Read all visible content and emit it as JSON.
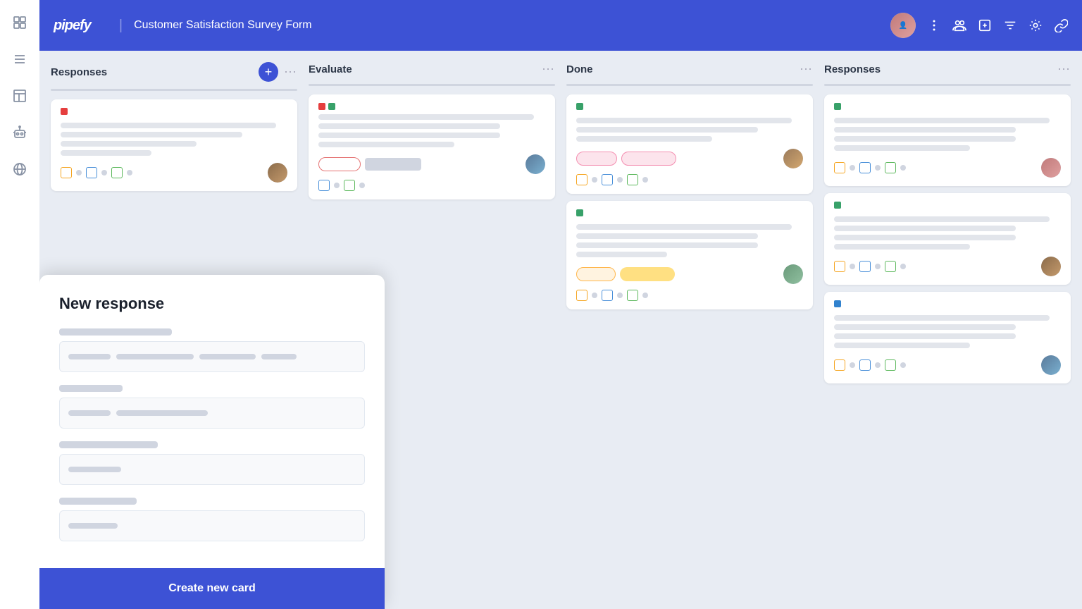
{
  "sidebar": {
    "icons": [
      "grid",
      "list",
      "table",
      "bot",
      "globe"
    ]
  },
  "header": {
    "logo": "pipefy",
    "title": "Customer Satisfaction Survey Form",
    "actions": [
      "people",
      "export",
      "filter",
      "settings",
      "link"
    ]
  },
  "columns": [
    {
      "id": "responses-1",
      "title": "Responses",
      "hasAdd": true,
      "cards": [
        {
          "indicator": "red",
          "lines": [
            "long",
            "medium",
            "short",
            "tiny"
          ],
          "badges": [],
          "icons": [
            "orange",
            "blue",
            "green"
          ],
          "avatar": "av1"
        }
      ]
    },
    {
      "id": "evaluate",
      "title": "Evaluate",
      "hasAdd": false,
      "cards": [
        {
          "indicators": [
            "red",
            "green"
          ],
          "lines": [
            "long",
            "medium",
            "medium",
            "short"
          ],
          "badges": [
            "outline"
          ],
          "icons": [
            "blue",
            "green"
          ],
          "avatar": "av2"
        }
      ]
    },
    {
      "id": "done",
      "title": "Done",
      "hasAdd": false,
      "cards": [
        {
          "indicator": "green",
          "lines": [
            "long",
            "medium",
            "short"
          ],
          "badges": [
            "pink",
            "pinkfill"
          ],
          "icons": [
            "orange",
            "blue",
            "green"
          ],
          "avatar": "av3"
        },
        {
          "indicator": "green",
          "lines": [
            "long",
            "medium",
            "medium",
            "short"
          ],
          "badges": [
            "orange",
            "orangefill"
          ],
          "icons": [
            "orange",
            "blue",
            "green"
          ],
          "avatar": "av5"
        }
      ]
    },
    {
      "id": "responses-2",
      "title": "Responses",
      "hasAdd": false,
      "cards": [
        {
          "indicator": "green",
          "lines": [
            "long",
            "medium",
            "medium",
            "short"
          ],
          "badges": [],
          "icons": [
            "orange",
            "blue",
            "green"
          ],
          "avatar": "av4"
        },
        {
          "indicator": "green",
          "lines": [
            "long",
            "medium",
            "medium",
            "short"
          ],
          "badges": [],
          "icons": [
            "orange",
            "blue",
            "green"
          ],
          "avatar": "av1"
        },
        {
          "indicator": "blue",
          "lines": [
            "long",
            "medium",
            "medium",
            "short"
          ],
          "badges": [],
          "icons": [
            "orange",
            "blue",
            "green"
          ],
          "avatar": "av2"
        }
      ]
    }
  ],
  "modal": {
    "title": "New response",
    "fields": [
      {
        "labelWidth": 160,
        "inputPlaceholders": [
          60,
          110,
          80,
          50
        ]
      },
      {
        "labelWidth": 90,
        "inputPlaceholders": [
          60,
          130
        ]
      },
      {
        "labelWidth": 120,
        "inputPlaceholders": [
          75
        ]
      },
      {
        "labelWidth": 100,
        "inputPlaceholders": [
          75
        ]
      }
    ],
    "submitLabel": "Create new card"
  }
}
